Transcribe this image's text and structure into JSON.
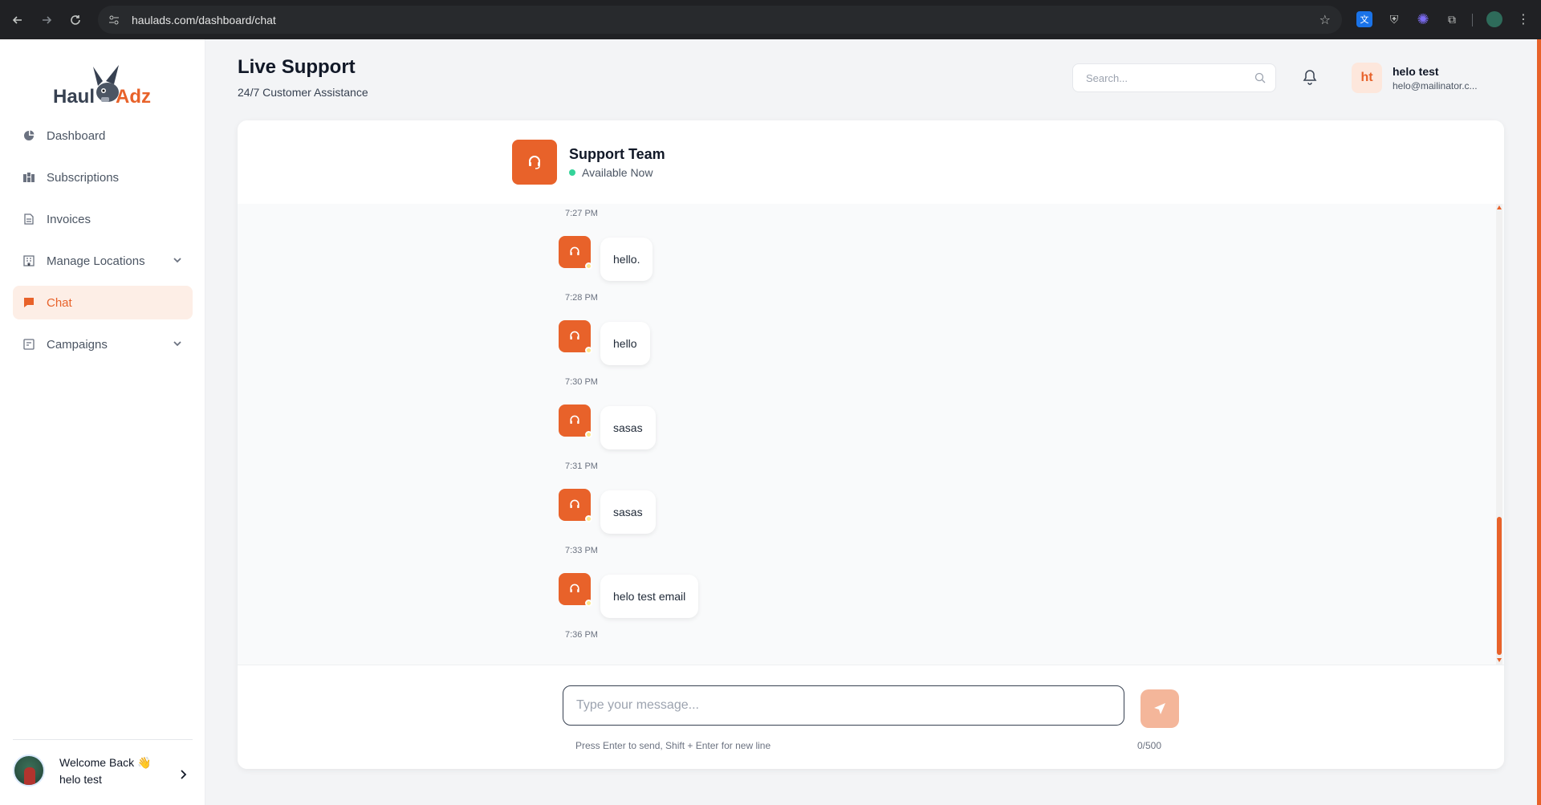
{
  "browser": {
    "url": "haulads.com/dashboard/chat"
  },
  "brand": {
    "name_part1": "Haul",
    "name_part2": "Adz",
    "accent": "#e8622a"
  },
  "sidebar": {
    "items": [
      {
        "label": "Dashboard",
        "icon": "pie-chart-icon",
        "active": false,
        "expandable": false
      },
      {
        "label": "Subscriptions",
        "icon": "grid-icon",
        "active": false,
        "expandable": false
      },
      {
        "label": "Invoices",
        "icon": "document-icon",
        "active": false,
        "expandable": false
      },
      {
        "label": "Manage Locations",
        "icon": "building-icon",
        "active": false,
        "expandable": true
      },
      {
        "label": "Chat",
        "icon": "chat-icon",
        "active": true,
        "expandable": false
      },
      {
        "label": "Campaigns",
        "icon": "campaign-icon",
        "active": false,
        "expandable": true
      }
    ],
    "footer": {
      "welcome": "Welcome Back 👋",
      "name": "helo test"
    }
  },
  "header": {
    "title": "Live Support",
    "subtitle": "24/7 Customer Assistance",
    "search_placeholder": "Search...",
    "user_initials": "ht",
    "user_name": "helo test",
    "user_email": "helo@mailinator.c..."
  },
  "chat": {
    "team_name": "Support Team",
    "team_status": "Available Now",
    "first_time": "7:27 PM",
    "messages": [
      {
        "text": "hello.",
        "time": "7:28 PM"
      },
      {
        "text": "hello",
        "time": "7:30 PM"
      },
      {
        "text": "sasas",
        "time": "7:31 PM"
      },
      {
        "text": "sasas",
        "time": "7:33 PM"
      },
      {
        "text": "helo test email",
        "time": "7:36 PM"
      }
    ],
    "input_placeholder": "Type your message...",
    "hint": "Press Enter to send, Shift + Enter for new line",
    "counter": "0/500"
  }
}
